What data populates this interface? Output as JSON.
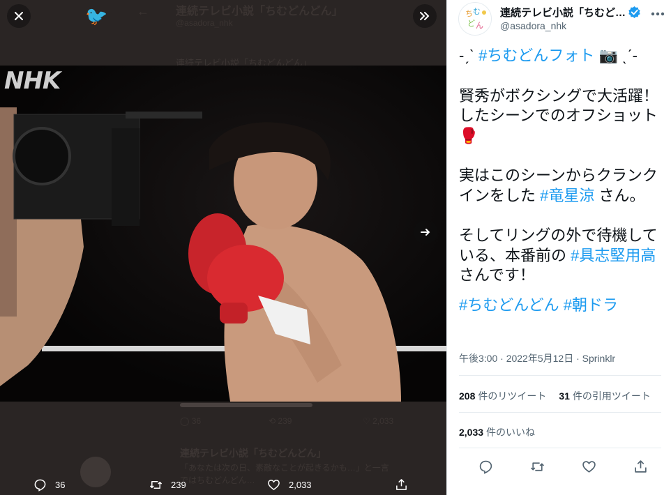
{
  "viewer": {
    "background_tweet": {
      "account_name": "連続テレビ小説「ちむどんどん」",
      "handle": "@asadora_nhk",
      "text_line": "連続テレビ小説「ちむどんどん」",
      "reply_name": "連続テレビ小説「ちむどんどん」",
      "reply_line1": "「あなたは次の日、素敵なことが起きるかも…」と一言",
      "reply_line2": "ではちむどんどん…"
    },
    "photo": {
      "logo_text": "NHK"
    },
    "actions": {
      "replies": "36",
      "retweets": "239",
      "likes": "2,033"
    }
  },
  "tweet": {
    "account_name": "連続テレビ小説「ちむど…",
    "handle": "@asadora_nhk",
    "avatar_text": "ちむどん",
    "line1_prefix": "-ˏˋ ",
    "line1_hashtag": "#ちむどんフォト",
    "line1_suffix": " 📷 ˎˊ-",
    "para2": "賢秀がボクシングで大活躍！したシーンでのオフショット🥊",
    "para3_a": "実はこのシーンからクランクインをした ",
    "para3_hashtag": "#竜星涼",
    "para3_b": " さん。",
    "para4_a": "そしてリングの外で待機している、本番前の ",
    "para4_hashtag": "#具志堅用高",
    "para4_b": " さんです！",
    "hashtag_a": "#ちむどんどん",
    "hashtag_b": "#朝ドラ",
    "meta": "午後3:00 · 2022年5月12日 · Sprinklr",
    "retweet_count": "208",
    "retweet_label": "件のリツイート",
    "quote_count": "31",
    "quote_label": "件の引用ツイート",
    "like_count": "2,033",
    "like_label": "件のいいね"
  },
  "colors": {
    "accent": "#1d9bf0",
    "text": "#0f1419",
    "muted": "#536471"
  },
  "icons": [
    "close-icon",
    "collapse-icon",
    "next-arrow-icon",
    "reply-icon",
    "retweet-icon",
    "like-icon",
    "share-icon",
    "verified-icon",
    "more-icon"
  ]
}
